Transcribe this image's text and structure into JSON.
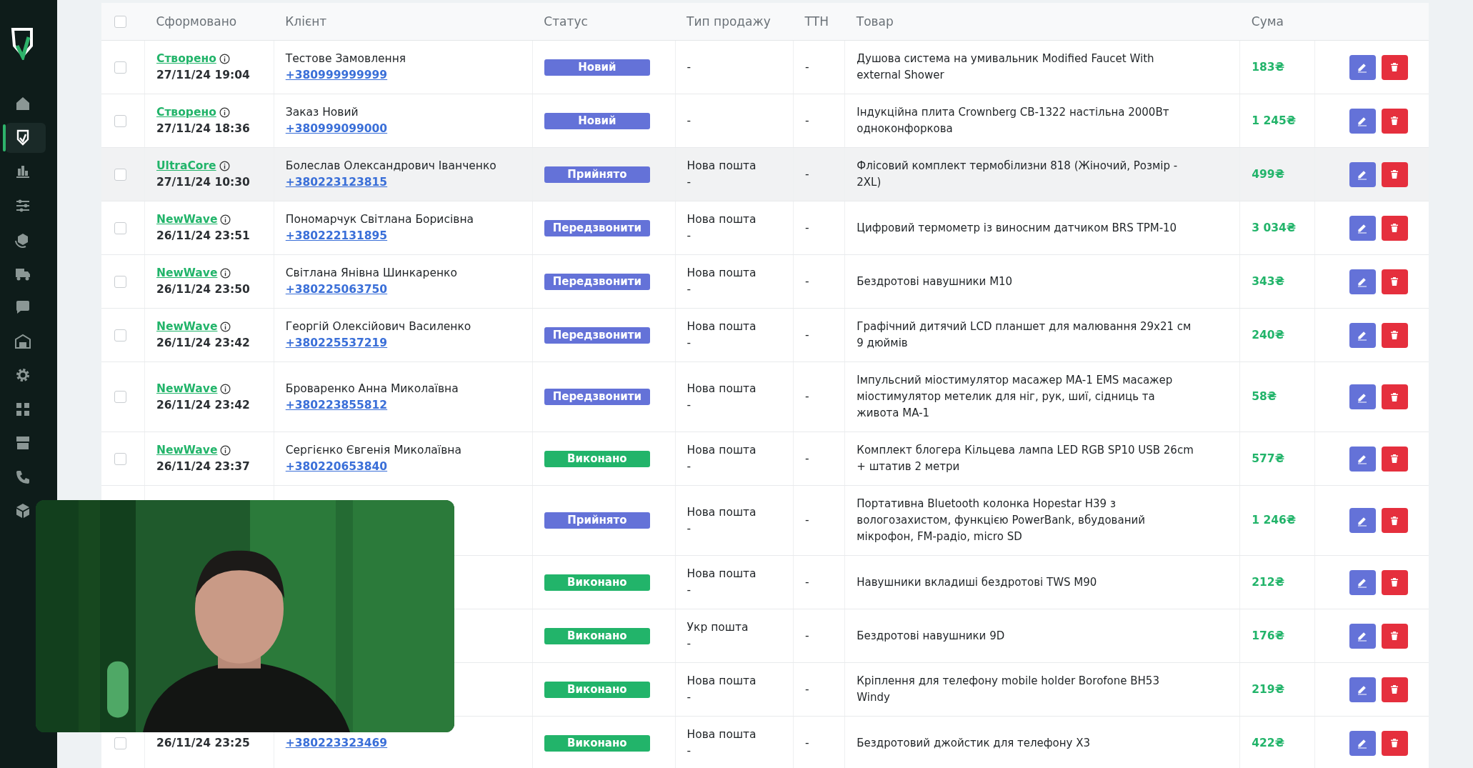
{
  "sidebar": {
    "items": [
      {
        "kind": "home",
        "selected": false
      },
      {
        "kind": "orders",
        "selected": true
      },
      {
        "kind": "stats",
        "selected": false
      },
      {
        "kind": "filters",
        "selected": false
      },
      {
        "kind": "products",
        "selected": false
      },
      {
        "kind": "delivery",
        "selected": false
      },
      {
        "kind": "chat",
        "selected": false
      },
      {
        "kind": "warehouse",
        "selected": false
      },
      {
        "kind": "settings",
        "selected": false
      },
      {
        "kind": "dashboard",
        "selected": false
      },
      {
        "kind": "store",
        "selected": false
      },
      {
        "kind": "phone",
        "selected": false
      },
      {
        "kind": "box",
        "selected": false
      }
    ]
  },
  "table": {
    "select_all": {
      "checked": false
    },
    "columns": [
      "Сформовано",
      "Клієнт",
      "Статус",
      "Тип продажу",
      "ТТН",
      "Товар",
      "Сума"
    ],
    "rows": [
      {
        "checked": false,
        "hovered": false,
        "source": "Створено",
        "date": "27/11/24 19:04",
        "client": "Тестове Замовлення",
        "phone": "+380999999999",
        "status": {
          "label": "Новий",
          "color": "#6472d8"
        },
        "sale_type": [
          "-"
        ],
        "ttn": "-",
        "product": "Душова система на умивальник Modified Faucet With external Shower",
        "sum": "183₴"
      },
      {
        "checked": false,
        "hovered": false,
        "source": "Створено",
        "date": "27/11/24 18:36",
        "client": "Заказ Новий",
        "phone": "+380999099000",
        "status": {
          "label": "Новий",
          "color": "#6472d8"
        },
        "sale_type": [
          "-"
        ],
        "ttn": "-",
        "product": "Індукційна плита Crownberg CB-1322 настільна 2000Вт одноконфоркова",
        "sum": "1 245₴"
      },
      {
        "checked": false,
        "hovered": true,
        "source": "UltraCore",
        "date": "27/11/24 10:30",
        "client": "Болеслав Олександрович Іванченко",
        "phone": "+380223123815",
        "status": {
          "label": "Прийнято",
          "color": "#6472d8"
        },
        "sale_type": [
          "Нова пошта",
          "-"
        ],
        "ttn": "-",
        "product": "Флісовий комплект термобілизни 818 (Жіночий, Розмір - 2XL)",
        "sum": "499₴"
      },
      {
        "checked": false,
        "hovered": false,
        "source": "NewWave",
        "date": "26/11/24 23:51",
        "client": "Пономарчук Світлана Борисівна",
        "phone": "+380222131895",
        "status": {
          "label": "Передзвонити",
          "color": "#6472d8"
        },
        "sale_type": [
          "Нова пошта",
          "-"
        ],
        "ttn": "-",
        "product": "Цифровий термометр із виносним датчиком BRS TPM-10",
        "sum": "3 034₴"
      },
      {
        "checked": false,
        "hovered": false,
        "source": "NewWave",
        "date": "26/11/24 23:50",
        "client": "Світлана Янівна Шинкаренко",
        "phone": "+380225063750",
        "status": {
          "label": "Передзвонити",
          "color": "#6472d8"
        },
        "sale_type": [
          "Нова пошта",
          "-"
        ],
        "ttn": "-",
        "product": "Бездротові навушники M10",
        "sum": "343₴"
      },
      {
        "checked": false,
        "hovered": false,
        "source": "NewWave",
        "date": "26/11/24 23:42",
        "client": "Георгій Олексійович Василенко",
        "phone": "+380225537219",
        "status": {
          "label": "Передзвонити",
          "color": "#6472d8"
        },
        "sale_type": [
          "Нова пошта",
          "-"
        ],
        "ttn": "-",
        "product": "Графічний дитячий LCD планшет для малювання 29x21 см 9 дюймів",
        "sum": "240₴"
      },
      {
        "checked": false,
        "hovered": false,
        "source": "NewWave",
        "date": "26/11/24 23:42",
        "client": "Броваренко Анна Миколаївна",
        "phone": "+380223855812",
        "status": {
          "label": "Передзвонити",
          "color": "#6472d8"
        },
        "sale_type": [
          "Нова пошта",
          "-"
        ],
        "ttn": "-",
        "product": "Імпульсний міостимулятор масажер MA-1 EMS масажер міостимулятор метелик для ніг, рук, шиї, сідниць та живота MA-1",
        "sum": "58₴"
      },
      {
        "checked": false,
        "hovered": false,
        "source": "NewWave",
        "date": "26/11/24 23:37",
        "client": "Сергієнко Євгенія Миколаївна",
        "phone": "+380220653840",
        "status": {
          "label": "Виконано",
          "color": "#22b46a"
        },
        "sale_type": [
          "Нова пошта",
          "-"
        ],
        "ttn": "-",
        "product": "Комплект блогера Кільцева лампа LED RGB SP10 USB 26cm + штатив 2 метри",
        "sum": "577₴"
      },
      {
        "hovered": false,
        "status": {
          "label": "Прийнято",
          "color": "#6472d8"
        },
        "sale_type": [
          "Нова пошта",
          "-"
        ],
        "ttn": "-",
        "product": "Портативна Bluetooth колонка Hopestar H39 з вологозахистом, функцією PowerBank, вбудований мікрофон, FM-радіо, micro SD",
        "sum": "1 246₴"
      },
      {
        "hovered": false,
        "status": {
          "label": "Виконано",
          "color": "#22b46a"
        },
        "sale_type": [
          "Нова пошта",
          "-"
        ],
        "ttn": "-",
        "product": "Навушники вкладиші бездротові TWS M90",
        "sum": "212₴"
      },
      {
        "hovered": false,
        "status": {
          "label": "Виконано",
          "color": "#22b46a"
        },
        "sale_type": [
          "Укр пошта",
          "-"
        ],
        "ttn": "-",
        "product": "Бездротові навушники 9D",
        "sum": "176₴"
      },
      {
        "hovered": false,
        "status": {
          "label": "Виконано",
          "color": "#22b46a"
        },
        "sale_type": [
          "Нова пошта",
          "-"
        ],
        "ttn": "-",
        "product": "Кріплення для телефону mobile holder Borofone BH53 Windy",
        "sum": "219₴"
      },
      {
        "checked": false,
        "hovered": false,
        "date": "26/11/24 23:25",
        "phone": "+380223323469",
        "status": {
          "label": "Виконано",
          "color": "#22b46a"
        },
        "sale_type": [
          "Нова пошта",
          "-"
        ],
        "ttn": "-",
        "product": "Бездротовий джойстик для телефону X3",
        "sum": "422₴"
      }
    ]
  }
}
